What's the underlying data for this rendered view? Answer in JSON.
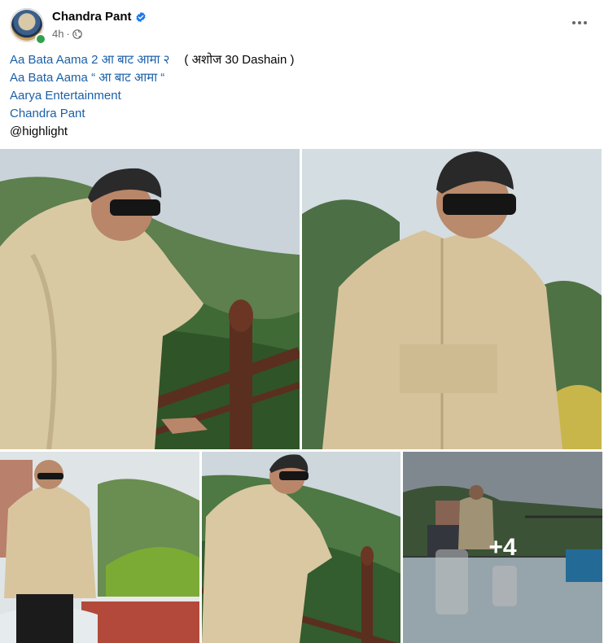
{
  "post": {
    "author": "Chandra Pant",
    "verified": true,
    "time": "4h",
    "audience_icon": "globe-icon",
    "more_icon": "more-options-icon"
  },
  "text": {
    "line1_link": "Aa Bata Aama 2 आ बाट आमा २",
    "line1_note": "( अशोज 30 Dashain )",
    "line2": "Aa Bata Aama “ आ बाट आमा “",
    "line3": "Aarya Entertainment",
    "line4": "Chandra Pant",
    "line5": "@highlight"
  },
  "photos": {
    "count": 5,
    "more_overlay": "+4"
  },
  "colors": {
    "link": "#1a5fa8",
    "online": "#31a24c",
    "verified": "#1877f2"
  }
}
